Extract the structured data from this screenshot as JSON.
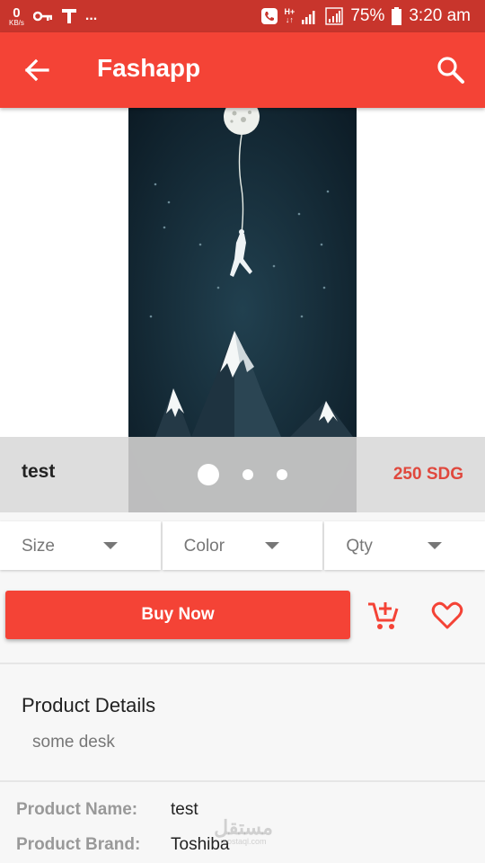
{
  "status_bar": {
    "net_speed": "0",
    "net_unit": "KB/s",
    "extra": "...",
    "ht_top": "H+",
    "ht_bottom": "↓↑",
    "battery": "75%",
    "time": "3:20 am"
  },
  "app_bar": {
    "title": "Fashapp",
    "back_icon": "arrow-left",
    "search_icon": "magnifier"
  },
  "product": {
    "title": "test",
    "price": "250 SDG",
    "carousel": {
      "slides": 3,
      "active": 0
    }
  },
  "selectors": [
    {
      "label": "Size"
    },
    {
      "label": "Color"
    },
    {
      "label": "Qty"
    }
  ],
  "actions": {
    "buy_label": "Buy Now",
    "cart_icon": "add-to-cart",
    "favorite_icon": "heart-outline"
  },
  "details": {
    "title": "Product Details",
    "description": "some desk"
  },
  "specs": [
    {
      "key": "Product Name:",
      "value": "test"
    },
    {
      "key": "Product Brand:",
      "value": "Toshiba"
    }
  ],
  "watermark": {
    "arabic": "مستقل",
    "latin": "mostaql.com"
  },
  "colors": {
    "primary": "#f44336",
    "status_bar": "#c8352c",
    "price": "#e0483d",
    "hero_bg": "#11232f"
  }
}
